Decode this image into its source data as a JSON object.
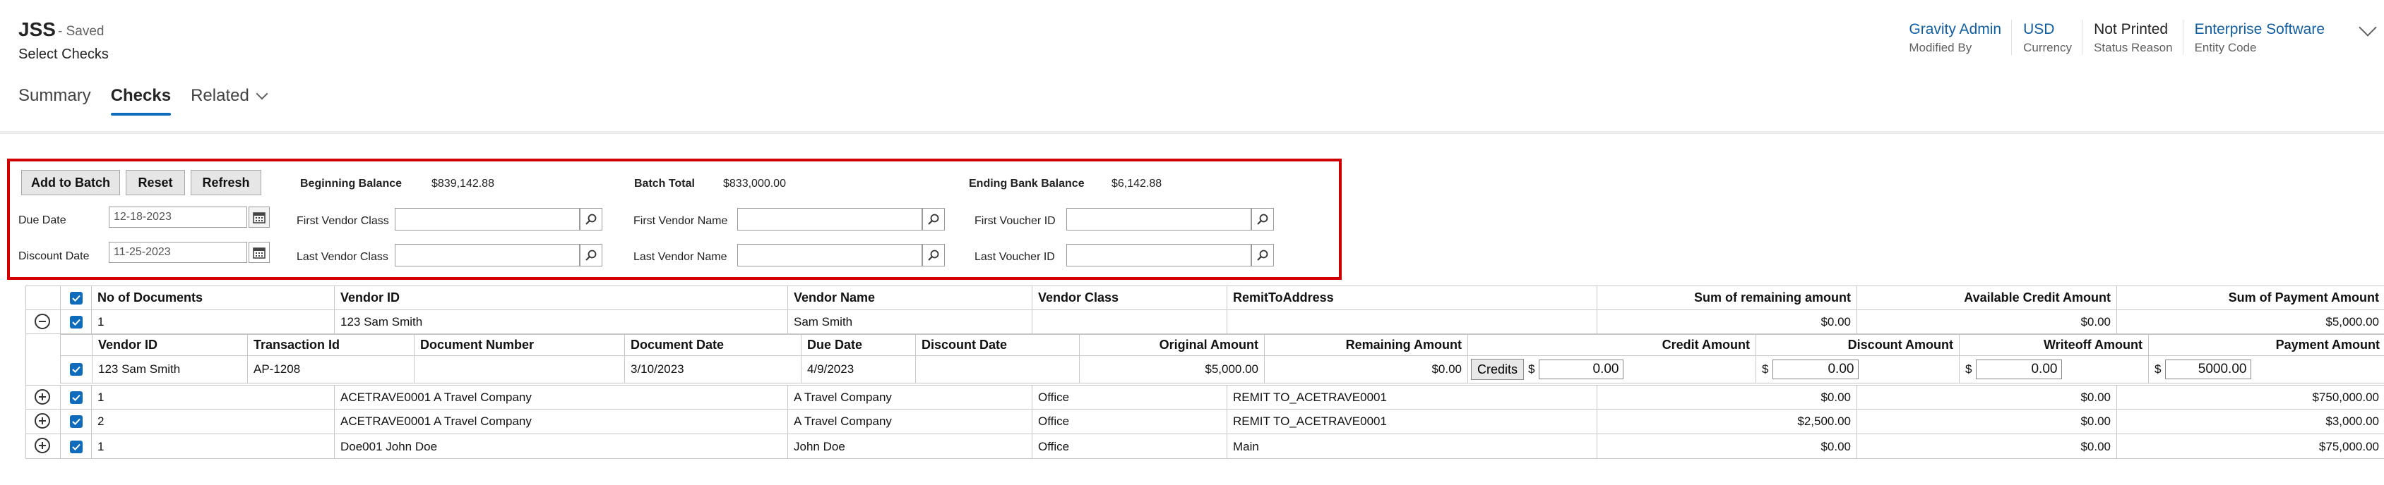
{
  "header": {
    "title": "JSS",
    "status": "- Saved",
    "subtitle": "Select Checks",
    "fields": [
      {
        "value": "Gravity Admin",
        "label": "Modified By",
        "link": true
      },
      {
        "value": "USD",
        "label": "Currency",
        "link": true
      },
      {
        "value": "Not Printed",
        "label": "Status Reason",
        "link": false
      },
      {
        "value": "Enterprise Software",
        "label": "Entity Code",
        "link": true
      }
    ]
  },
  "tabs": [
    "Summary",
    "Checks",
    "Related"
  ],
  "controls": {
    "add_to_batch": "Add to Batch",
    "reset": "Reset",
    "refresh": "Refresh",
    "beginning_balance_label": "Beginning Balance",
    "beginning_balance": "$839,142.88",
    "batch_total_label": "Batch Total",
    "batch_total": "$833,000.00",
    "ending_balance_label": "Ending Bank Balance",
    "ending_balance": "$6,142.88",
    "due_date_label": "Due Date",
    "due_date": "12-18-2023",
    "discount_date_label": "Discount Date",
    "discount_date": "11-25-2023",
    "first_vendor_class": "First Vendor Class",
    "last_vendor_class": "Last Vendor Class",
    "first_vendor_name": "First Vendor Name",
    "last_vendor_name": "Last Vendor Name",
    "first_voucher_id": "First Voucher ID",
    "last_voucher_id": "Last Voucher ID"
  },
  "grid": {
    "headers": [
      "No of Documents",
      "Vendor ID",
      "Vendor Name",
      "Vendor Class",
      "RemitToAddress",
      "Sum of remaining amount",
      "Available Credit Amount",
      "Sum of Payment Amount"
    ],
    "rows": [
      {
        "docs": "1",
        "vendor_id": "123 Sam Smith",
        "vendor_name": "Sam Smith",
        "vendor_class": "",
        "remit": "",
        "remaining": "$0.00",
        "credit": "$0.00",
        "payment": "$5,000.00"
      },
      {
        "docs": "1",
        "vendor_id": "ACETRAVE0001 A Travel Company",
        "vendor_name": "A Travel Company",
        "vendor_class": "Office",
        "remit": "REMIT TO_ACETRAVE0001",
        "remaining": "$0.00",
        "credit": "$0.00",
        "payment": "$750,000.00"
      },
      {
        "docs": "2",
        "vendor_id": "ACETRAVE0001 A Travel Company",
        "vendor_name": "A Travel Company",
        "vendor_class": "Office",
        "remit": "REMIT TO_ACETRAVE0001",
        "remaining": "$2,500.00",
        "credit": "$0.00",
        "payment": "$3,000.00"
      },
      {
        "docs": "1",
        "vendor_id": "Doe001 John Doe",
        "vendor_name": "John Doe",
        "vendor_class": "Office",
        "remit": "Main",
        "remaining": "$0.00",
        "credit": "$0.00",
        "payment": "$75,000.00"
      }
    ],
    "sub_headers": [
      "Vendor ID",
      "Transaction Id",
      "Document Number",
      "Document Date",
      "Due Date",
      "Discount Date",
      "Original Amount",
      "Remaining Amount",
      "Credit Amount",
      "Discount Amount",
      "Writeoff Amount",
      "Payment Amount"
    ],
    "sub_row": {
      "vendor_id": "123 Sam Smith",
      "transaction_id": "AP-1208",
      "document_number": "",
      "document_date": "3/10/2023",
      "due_date": "4/9/2023",
      "discount_date": "",
      "original_amount": "$5,000.00",
      "remaining_amount": "$0.00",
      "credits_button": "Credits",
      "currency_symbol": "$",
      "credit_amount": "0.00",
      "discount_amount": "0.00",
      "writeoff_amount": "0.00",
      "payment_amount": "5000.00"
    }
  },
  "colors": {
    "accent": "#0f6cbd",
    "highlight_border": "#d00000",
    "link": "#115ea3"
  }
}
